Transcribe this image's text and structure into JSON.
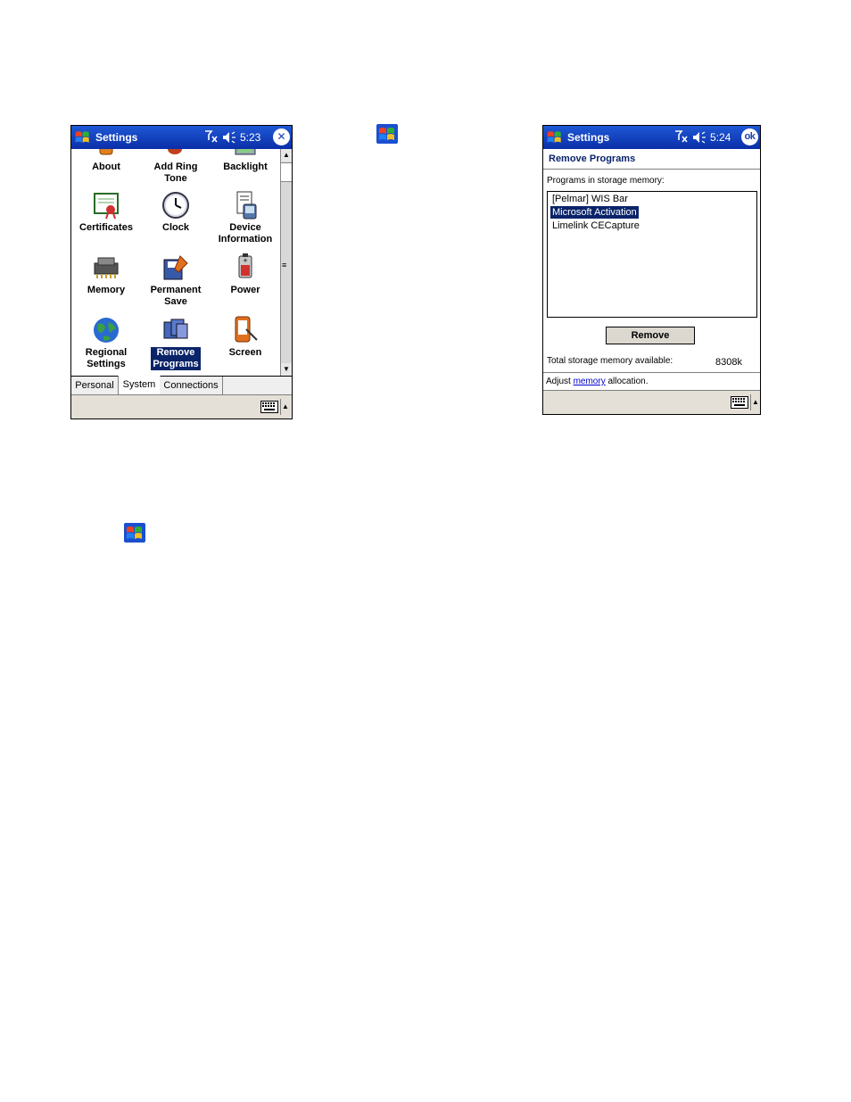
{
  "page_icons": {
    "top_flag": "windows-flag-icon",
    "bottom_flag": "windows-flag-icon"
  },
  "screen1": {
    "title": "Settings",
    "time": "5:23",
    "close_label": "✕",
    "icons": [
      {
        "label": "About",
        "icon": "about-icon"
      },
      {
        "label": "Add Ring\nTone",
        "icon": "ring-tone-icon"
      },
      {
        "label": "Backlight",
        "icon": "backlight-icon"
      },
      {
        "label": "Certificates",
        "icon": "certificate-icon"
      },
      {
        "label": "Clock",
        "icon": "clock-icon"
      },
      {
        "label": "Device\nInformation",
        "icon": "device-info-icon"
      },
      {
        "label": "Memory",
        "icon": "memory-chip-icon"
      },
      {
        "label": "Permanent\nSave",
        "icon": "permanent-save-icon"
      },
      {
        "label": "Power",
        "icon": "battery-icon"
      },
      {
        "label": "Regional\nSettings",
        "icon": "globe-icon"
      },
      {
        "label": "Remove\nPrograms",
        "icon": "remove-programs-icon",
        "selected": true
      },
      {
        "label": "Screen",
        "icon": "screen-stylus-icon"
      }
    ],
    "tabs": [
      "Personal",
      "System",
      "Connections"
    ],
    "active_tab": "System"
  },
  "screen2": {
    "title": "Settings",
    "time": "5:24",
    "ok_label": "ok",
    "heading": "Remove Programs",
    "list_label": "Programs in storage memory:",
    "programs": [
      "[Pelmar] WIS Bar",
      "Microsoft Activation",
      "Limelink CECapture"
    ],
    "selected_program": "Microsoft Activation",
    "remove_button": "Remove",
    "total_label": "Total storage memory available:",
    "total_value": "8308k",
    "adjust_prefix": "Adjust ",
    "adjust_link": "memory",
    "adjust_suffix": " allocation."
  },
  "colors": {
    "titlebar": "#1f58d6",
    "selection": "#0a246a",
    "heading": "#0a246a",
    "link": "#0000cc"
  }
}
